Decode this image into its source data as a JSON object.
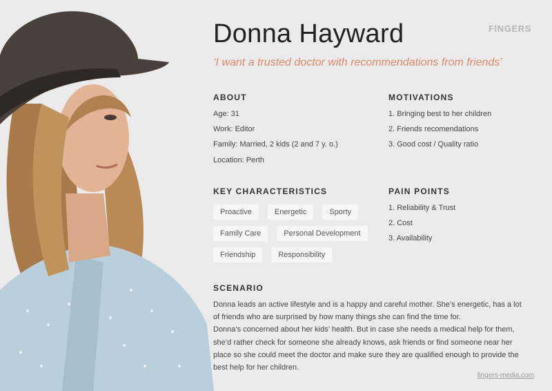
{
  "brand": "FINGERS",
  "persona": {
    "name": "Donna Hayward",
    "quote": "‘I want a trusted doctor with recommendations from friends’"
  },
  "about": {
    "title": "ABOUT",
    "lines": [
      "Age: 31",
      "Work: Editor",
      "Family: Married, 2 kids (2 and 7 y. o.)",
      "Location: Perth"
    ]
  },
  "motivations": {
    "title": "MOTIVATIONS",
    "items": [
      "1. Bringing best to her children",
      "2. Friends recomendations",
      "3. Good cost / Quality ratio"
    ]
  },
  "characteristics": {
    "title": "KEY CHARACTERISTICS",
    "chips": [
      "Proactive",
      "Energetic",
      "Sporty",
      "Family Care",
      "Personal Development",
      "Friendship",
      "Responsibility"
    ]
  },
  "pain_points": {
    "title": "PAIN POINTS",
    "items": [
      "1. Reliability & Trust",
      "2. Cost",
      "3. Availability"
    ]
  },
  "scenario": {
    "title": "SCENARIO",
    "paragraph1": "Donna leads an active lifestyle and is a happy and careful mother. She’s energetic, has a lot of friends who are surprised by how many things she can find the time for.",
    "paragraph2": "Donna’s concerned about her kids’ health. But in case she needs a medical help for them, she’d rather check for someone she already knows, ask friends or find someone near her place so she could meet the doctor and make sure they are qualified enough to provide the best help for her children."
  },
  "footer": {
    "site": "fingers-media.com"
  },
  "colors": {
    "background": "#ebebeb",
    "accent": "#e08866",
    "chip": "#f7f7f7"
  }
}
